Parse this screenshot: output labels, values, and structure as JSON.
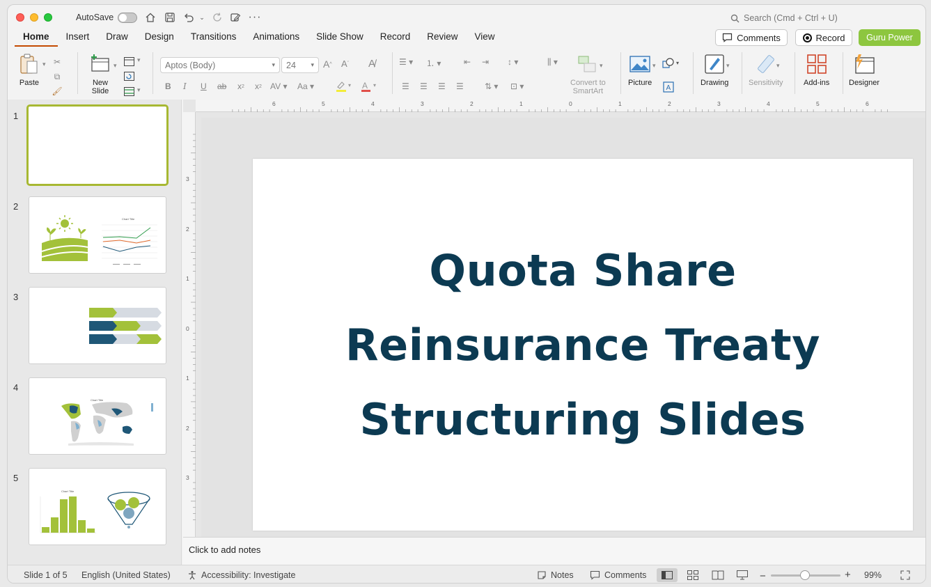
{
  "titlebar": {
    "autosave_label": "AutoSave",
    "search_placeholder": "Search (Cmd + Ctrl + U)"
  },
  "tabs": [
    {
      "label": "Home",
      "active": true
    },
    {
      "label": "Insert"
    },
    {
      "label": "Draw"
    },
    {
      "label": "Design"
    },
    {
      "label": "Transitions"
    },
    {
      "label": "Animations"
    },
    {
      "label": "Slide Show"
    },
    {
      "label": "Record"
    },
    {
      "label": "Review"
    },
    {
      "label": "View"
    }
  ],
  "header_buttons": {
    "comments": "Comments",
    "record": "Record",
    "guru": "Guru Power"
  },
  "ribbon": {
    "paste": "Paste",
    "new_slide_line1": "New",
    "new_slide_line2": "Slide",
    "font_name": "Aptos (Body)",
    "font_size": "24",
    "convert_line1": "Convert to",
    "convert_line2": "SmartArt",
    "picture": "Picture",
    "drawing": "Drawing",
    "sensitivity": "Sensitivity",
    "addins": "Add-ins",
    "designer": "Designer"
  },
  "slides": [
    {
      "number": "1",
      "selected": true
    },
    {
      "number": "2",
      "thumb_chart_title": "Chart Title"
    },
    {
      "number": "3"
    },
    {
      "number": "4",
      "thumb_chart_title": "Chart Title"
    },
    {
      "number": "5",
      "thumb_chart_title": "Chart Title"
    }
  ],
  "rulers": {
    "horizontal": [
      "6",
      "5",
      "4",
      "3",
      "2",
      "1",
      "0",
      "1",
      "2",
      "3",
      "4",
      "5",
      "6"
    ],
    "vertical": [
      "3",
      "2",
      "1",
      "0",
      "1",
      "2",
      "3"
    ]
  },
  "slide_content": {
    "title_line1": "Quota Share",
    "title_line2": "Reinsurance Treaty",
    "title_line3": "Structuring Slides",
    "title_color": "#0c3a52"
  },
  "notes_placeholder": "Click to add notes",
  "status": {
    "slide_info": "Slide 1 of 5",
    "language": "English (United States)",
    "accessibility": "Accessibility: Investigate",
    "notes": "Notes",
    "comments": "Comments",
    "zoom_minus": "−",
    "zoom_plus": "+",
    "zoom_level": "99%"
  },
  "colors": {
    "accent_green": "#8dc63f",
    "active_tab_underline": "#c44a00",
    "thumb_green": "#a3c13a",
    "thumb_navy": "#1f5777"
  }
}
